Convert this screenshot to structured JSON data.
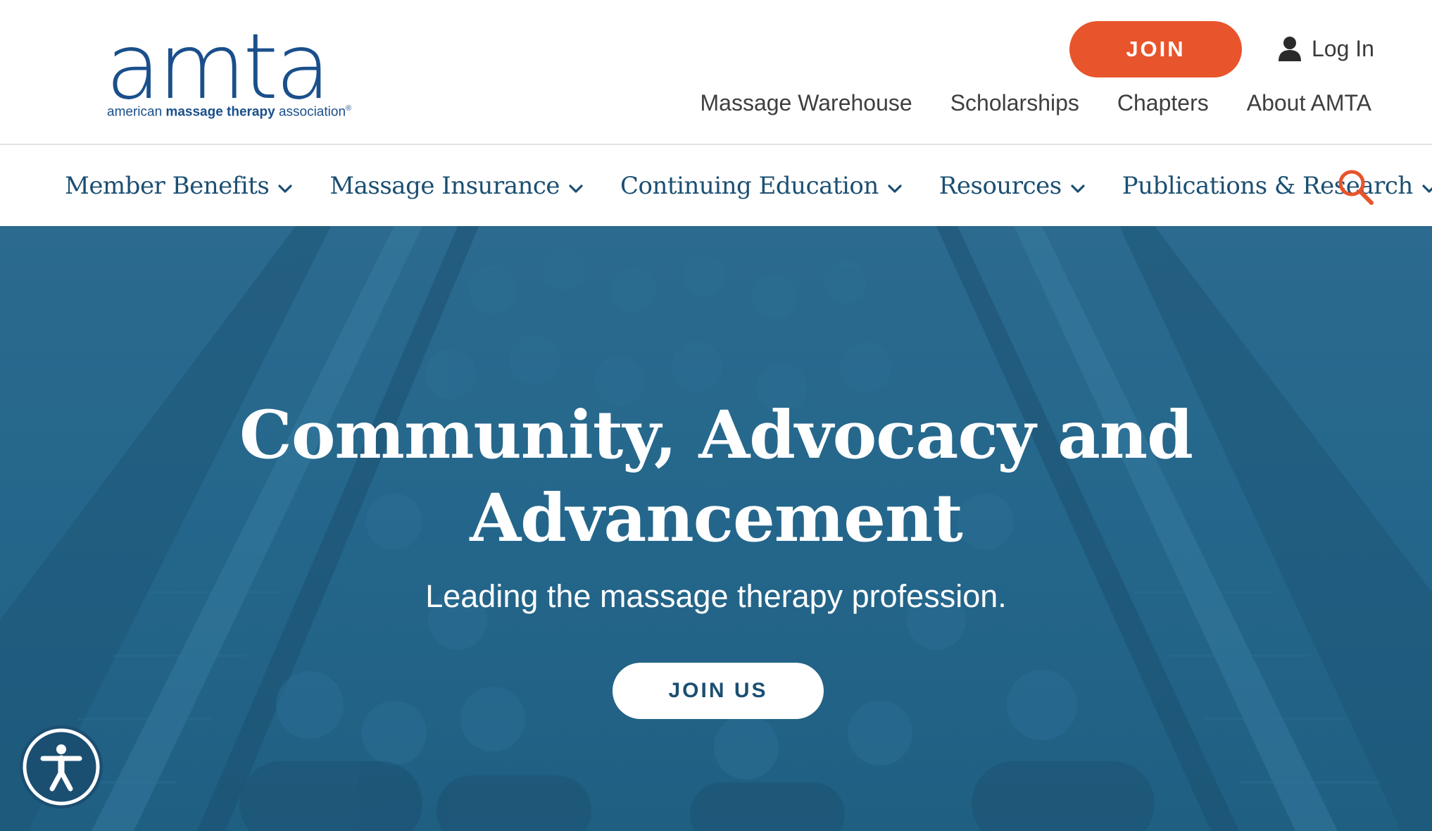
{
  "header": {
    "logo": {
      "word": "amta",
      "tag_pre": "american ",
      "tag_bold": "massage therapy",
      "tag_post": " association",
      "tag_mark": "®"
    },
    "join_label": "JOIN",
    "login_label": "Log In",
    "util_links": [
      "Massage Warehouse",
      "Scholarships",
      "Chapters",
      "About AMTA"
    ]
  },
  "nav": {
    "items": [
      "Member Benefits",
      "Massage Insurance",
      "Continuing Education",
      "Resources",
      "Publications & Research"
    ]
  },
  "hero": {
    "title_line1": "Community, Advocacy and",
    "title_line2": "Advancement",
    "subtitle": "Leading the massage therapy profession.",
    "cta_label": "JOIN US"
  },
  "colors": {
    "brand_blue": "#1a4f8b",
    "nav_text": "#1b4f72",
    "accent_orange": "#e8542b",
    "hero_overlay": "#25678c"
  }
}
